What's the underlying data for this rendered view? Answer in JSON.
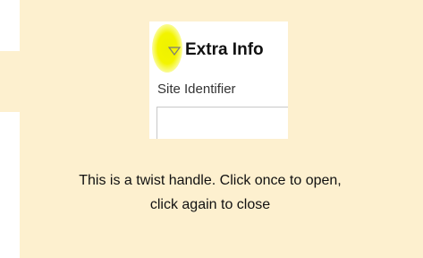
{
  "colors": {
    "callout_background": "#fdf0cf",
    "highlight": "#f3f400"
  },
  "panel": {
    "twist_handle_icon": "triangle-down-outline-icon",
    "section_title": "Extra Info",
    "field_label": "Site Identifier",
    "field_value": ""
  },
  "caption": {
    "line1": "This is a twist handle. Click once to open,",
    "line2": "click again to close"
  }
}
